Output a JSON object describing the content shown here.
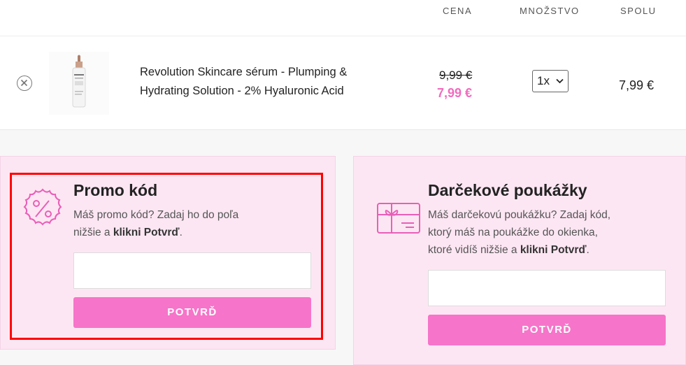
{
  "table_header": {
    "price": "CENA",
    "quantity": "MNOŽSTVO",
    "total": "SPOLU"
  },
  "cart_item": {
    "name_line1": "Revolution Skincare sérum - Plumping &",
    "name_line2": "Hydrating Solution - 2% Hyaluronic Acid",
    "old_price": "9,99 €",
    "price": "7,99 €",
    "quantity": "1x",
    "total": "7,99 €"
  },
  "promo": {
    "title": "Promo kód",
    "desc_line1": "Máš promo kód? Zadaj ho do poľa",
    "desc_line2_pre": "nižšie a ",
    "desc_bold": "klikni Potvrď",
    "desc_end": ".",
    "button": "POTVRĎ"
  },
  "gift": {
    "title": "Darčekové poukážky",
    "desc_line1": "Máš darčekovú poukážku? Zadaj kód,",
    "desc_line2": "ktorý máš na poukážke do okienka,",
    "desc_line3_pre": "ktoré vidíš nižšie a ",
    "desc_bold": "klikni Potvrď",
    "desc_end": ".",
    "button": "POTVRĎ"
  },
  "colors": {
    "accent": "#f674c9",
    "sale": "#f06bbf",
    "card_bg": "#fde6f3",
    "highlight": "#ff0000"
  }
}
